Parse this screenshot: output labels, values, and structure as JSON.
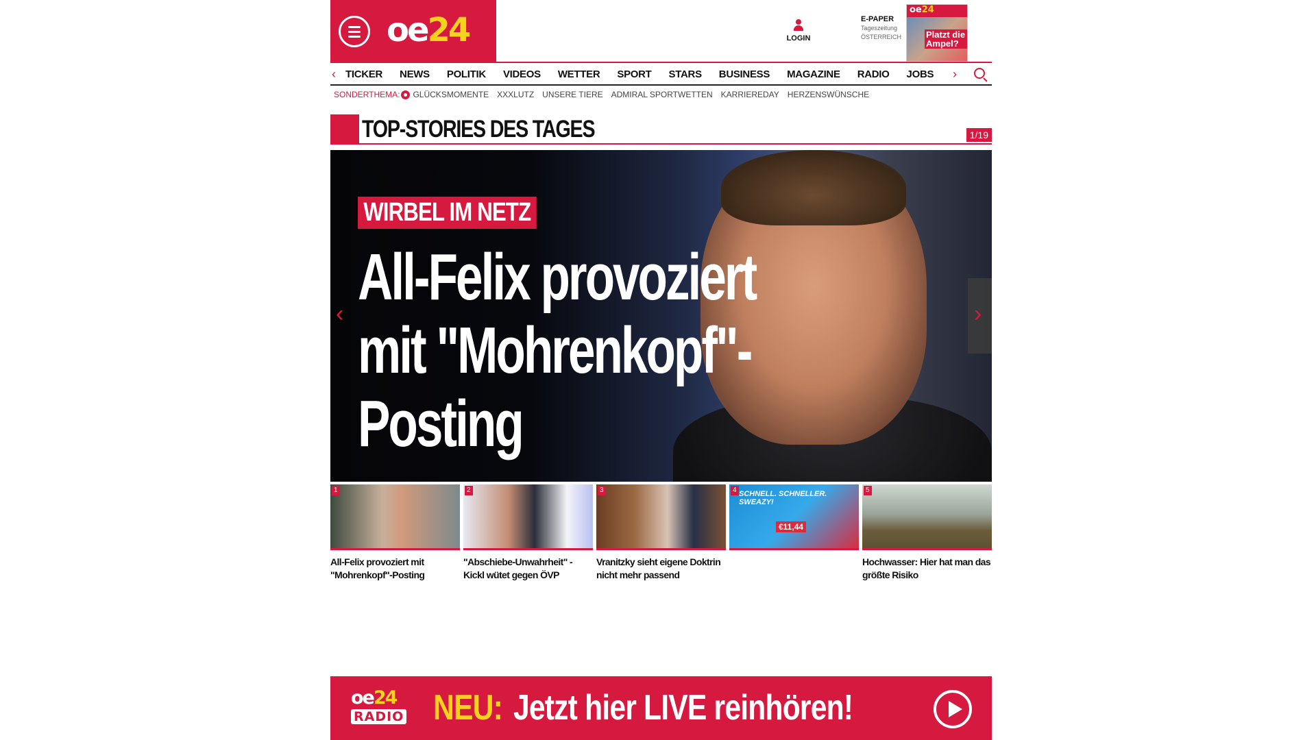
{
  "brand": {
    "logo_part1": "oe",
    "logo_part2": "24",
    "accent_color": "#d6193e",
    "logo_yellow": "#f6d21e"
  },
  "header": {
    "menu_icon": "hamburger-icon",
    "login_label": "LOGIN",
    "epaper": {
      "title": "E-PAPER",
      "line1": "Tageszeitung",
      "line2": "ÖSTERREICH",
      "cover_logo_part1": "oe",
      "cover_logo_part2": "24",
      "cover_headline": "Platzt die Ampel?"
    }
  },
  "nav": {
    "items": [
      "TICKER",
      "NEWS",
      "POLITIK",
      "VIDEOS",
      "WETTER",
      "SPORT",
      "STARS",
      "BUSINESS",
      "MAGAZINE",
      "RADIO",
      "JOBS"
    ],
    "prev_glyph": "‹",
    "next_glyph": "›"
  },
  "subnav": {
    "label": "SONDERTHEMA:",
    "items": [
      "GLÜCKSMOMENTE",
      "XXXLUTZ",
      "UNSERE TIERE",
      "ADMIRAL SPORTWETTEN",
      "KARRIEREDAY",
      "HERZENSWÜNSCHE"
    ]
  },
  "section": {
    "title": "TOP-STORIES DES TAGES",
    "counter": "1/19"
  },
  "hero": {
    "kicker": "WIRBEL IM NETZ",
    "headline": "All-Felix provoziert mit \"Mohrenkopf\"-Posting",
    "prev_glyph": "‹",
    "next_glyph": "›"
  },
  "thumbs": [
    {
      "num": "1",
      "title": "All-Felix provoziert mit \"Mohrenkopf\"-Posting"
    },
    {
      "num": "2",
      "title": "\"Abschiebe-Unwahrheit\" - Kickl wütet gegen ÖVP"
    },
    {
      "num": "3",
      "title": "Vranitzky sieht eigene Doktrin nicht mehr passend"
    },
    {
      "num": "4",
      "title": "",
      "ad_text": "SCHNELL. SCHNELLER. SWEAZY!",
      "ad_price": "€11,44"
    },
    {
      "num": "5",
      "title": "Hochwasser: Hier hat man das größte Risiko"
    }
  ],
  "radio": {
    "logo_part1": "oe",
    "logo_part2": "24",
    "logo_sub": "RADIO",
    "neu": "NEU:",
    "text": "Jetzt hier LIVE reinhören!"
  }
}
